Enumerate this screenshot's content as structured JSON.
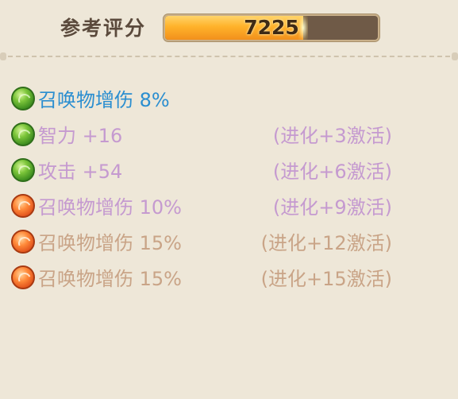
{
  "score": {
    "label": "参考评分",
    "value": "7225",
    "fill_fraction": 0.65
  },
  "attributes": [
    {
      "icon": "green-orb-icon",
      "name": "召唤物增伤 8%",
      "condition": "",
      "state": "active"
    },
    {
      "icon": "green-orb-icon",
      "name": "智力 +16",
      "condition": "(进化+3激活)",
      "state": "inactive-purple"
    },
    {
      "icon": "green-orb-icon",
      "name": "攻击 +54",
      "condition": "(进化+6激活)",
      "state": "inactive-purple"
    },
    {
      "icon": "orange-orb-icon",
      "name": "召唤物增伤 10%",
      "condition": "(进化+9激活)",
      "state": "inactive-purple"
    },
    {
      "icon": "orange-orb-icon",
      "name": "召唤物增伤 15%",
      "condition": "(进化+12激活)",
      "state": "inactive-tan"
    },
    {
      "icon": "orange-orb-icon",
      "name": "召唤物增伤 15%",
      "condition": "(进化+15激活)",
      "state": "inactive-tan"
    }
  ],
  "colors": {
    "active": "#2a8ed0",
    "inactive_purple": "#c59ad0",
    "inactive_tan": "#c9a487",
    "bar_fill": "#ffb22a"
  }
}
